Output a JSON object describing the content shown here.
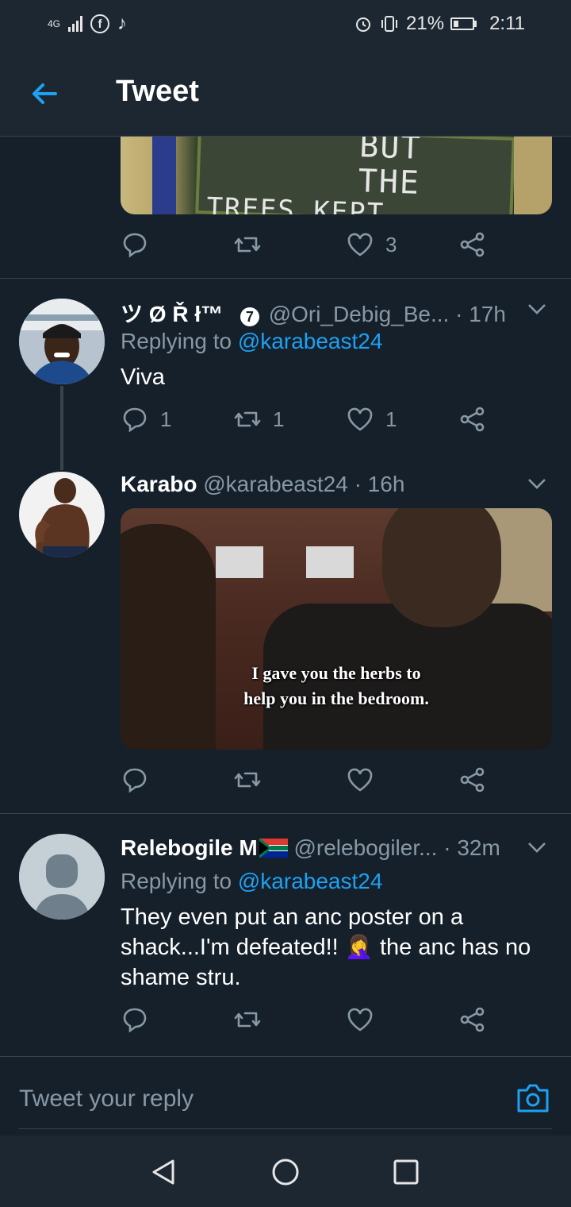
{
  "status_bar": {
    "network": "4G",
    "battery_percent": "21%",
    "time": "2:11",
    "icons": [
      "signal-icon",
      "facebook-icon",
      "tiktok-icon",
      "alarm-icon",
      "vibrate-icon",
      "battery-charging-icon"
    ]
  },
  "header": {
    "title": "Tweet"
  },
  "top_tweet": {
    "image_text": "TREES KEPT VOTING FOR THE",
    "image_text_top": "BUT THE",
    "like_count": "3"
  },
  "tweets": [
    {
      "name": "ツ Ø Ř ł™",
      "badge": "7",
      "handle": "@Ori_Debig_Be...",
      "time": "· 17h",
      "replying_label": "Replying to",
      "replying_handle": "@karabeast24",
      "text": "Viva",
      "reply_count": "1",
      "retweet_count": "1",
      "like_count": "1"
    },
    {
      "name": "Karabo",
      "handle": "@karabeast24",
      "time": "· 16h",
      "image_caption_line1": "I gave you the herbs to",
      "image_caption_line2": "help you in the bedroom."
    },
    {
      "name": "Relebogile M",
      "handle": "@relebogiler...",
      "time": "· 32m",
      "replying_label": "Replying to",
      "replying_handle": "@karabeast24",
      "text": "They even put an anc poster on a shack...I'm defeated!! 🤦‍♀️ the anc has no shame stru."
    }
  ],
  "composer": {
    "placeholder": "Tweet your reply"
  },
  "colors": {
    "background": "#15202b",
    "accent": "#1da1f2",
    "muted": "#8899a6",
    "divider": "#38444d"
  }
}
